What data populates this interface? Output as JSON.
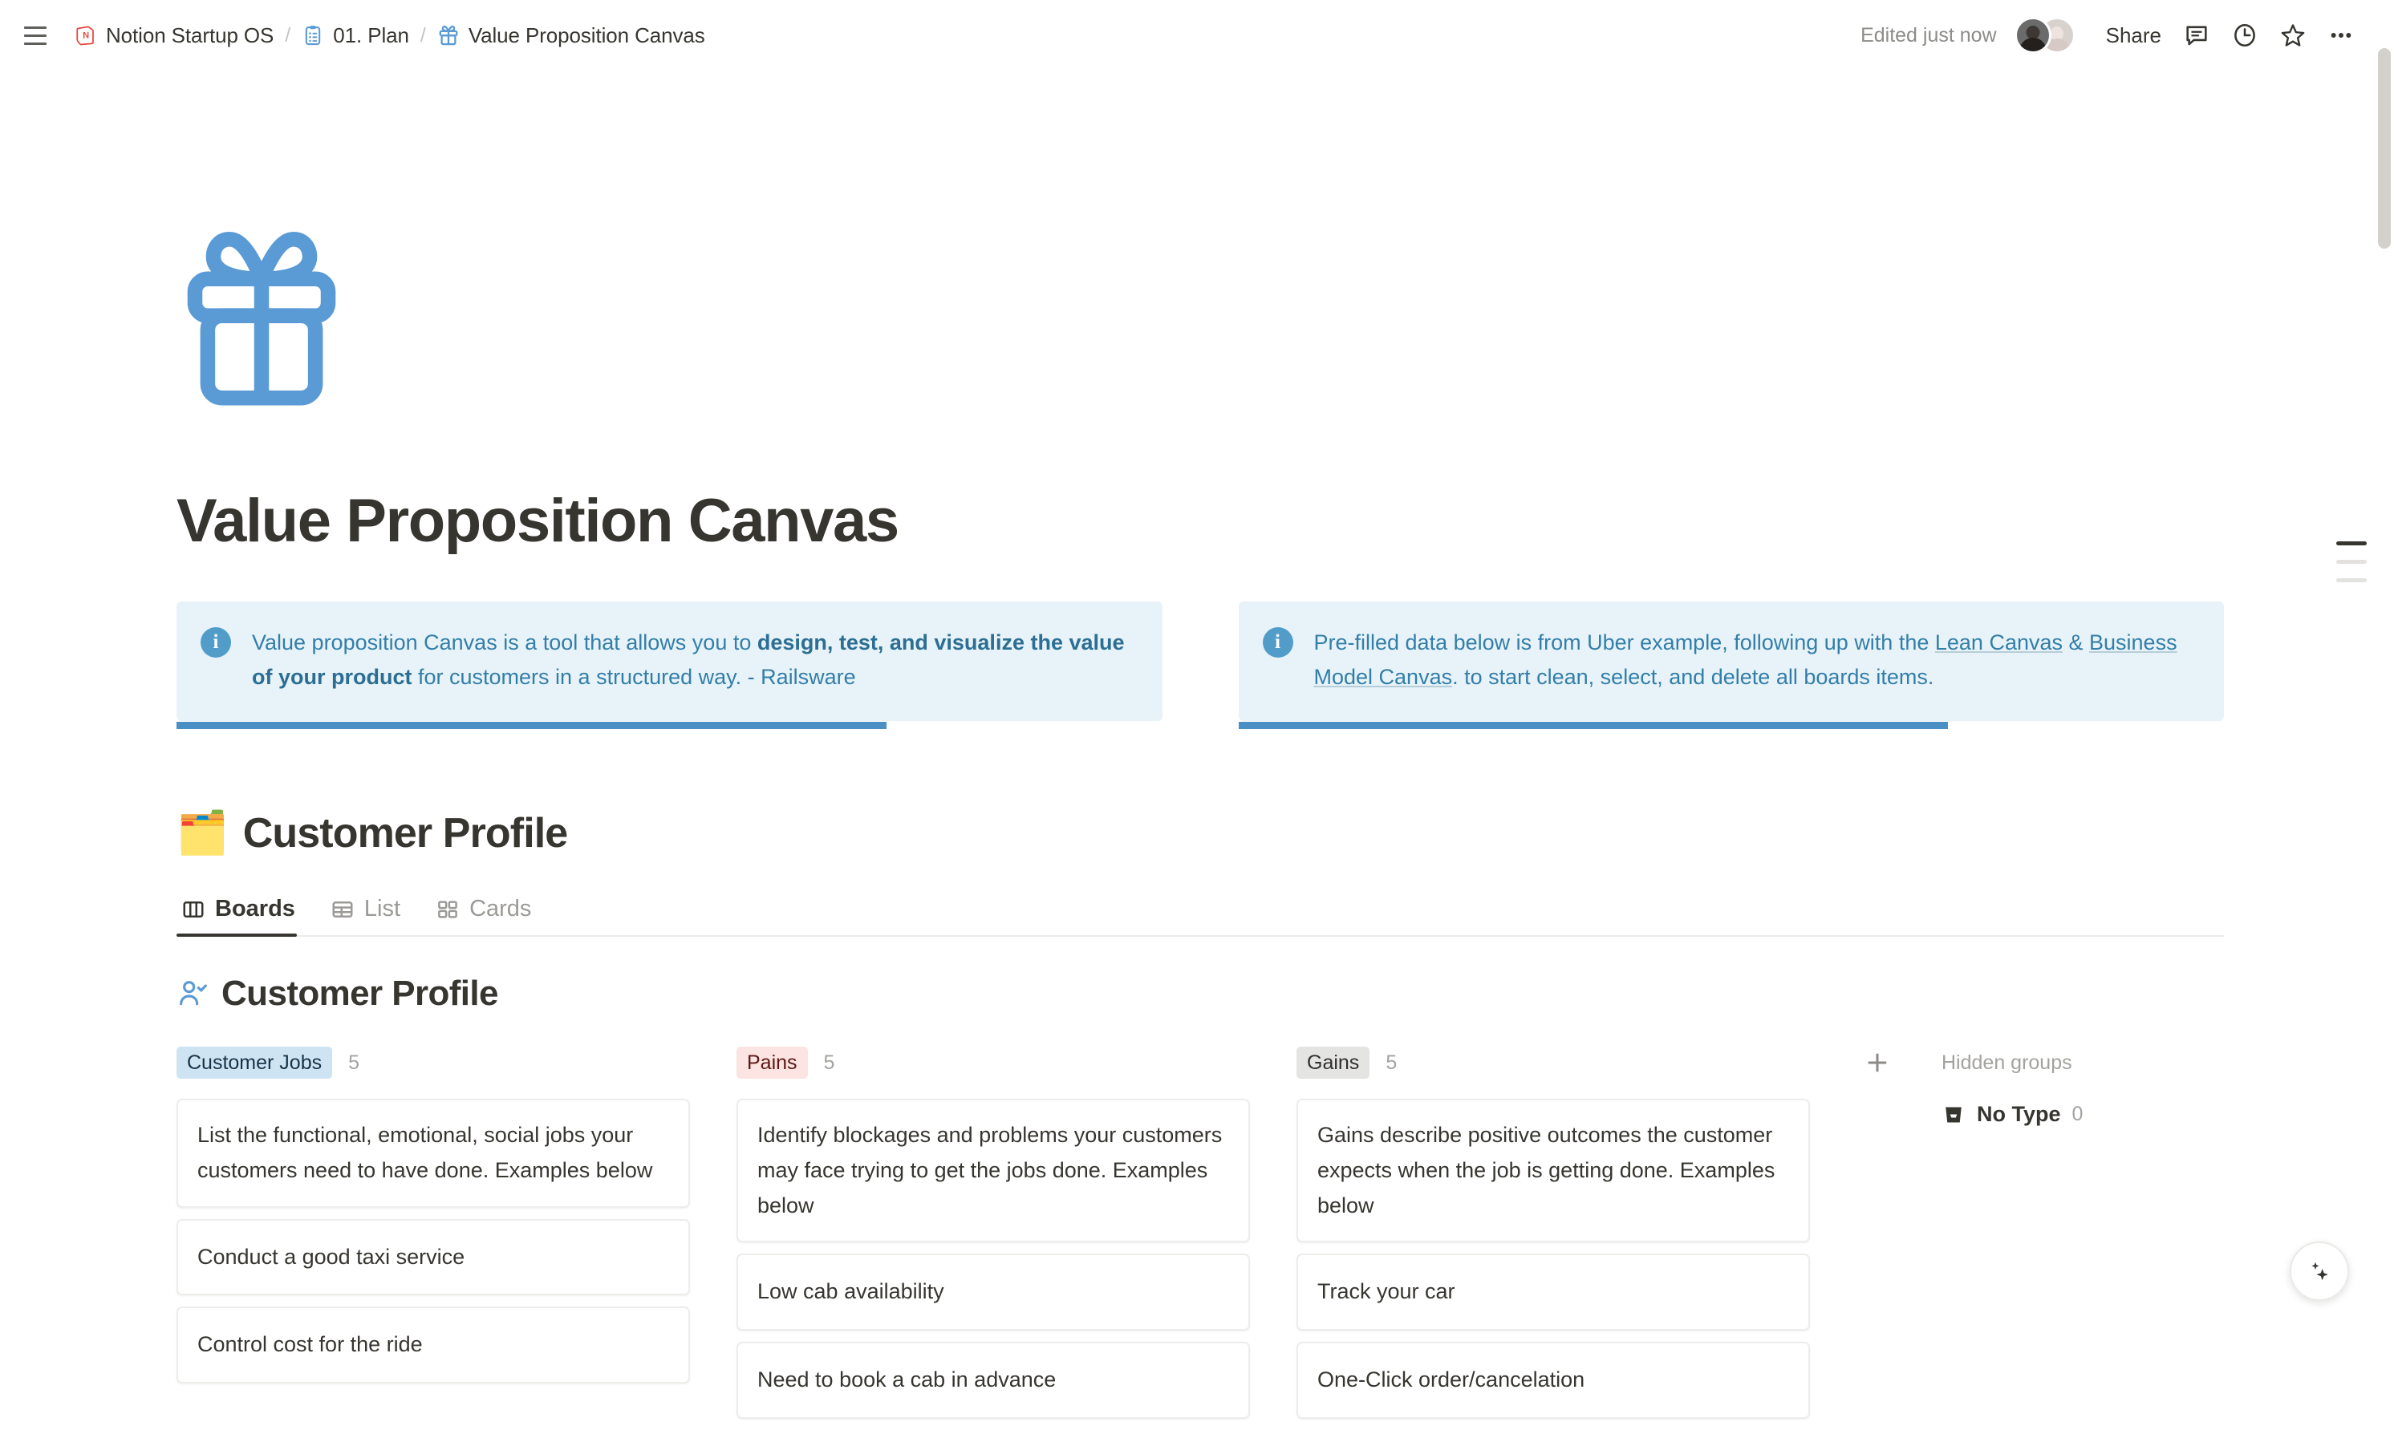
{
  "topbar": {
    "menu_icon": "hamburger-icon",
    "breadcrumbs": [
      {
        "icon": "notion-logo-icon",
        "label": "Notion Startup OS"
      },
      {
        "icon": "clipboard-icon",
        "label": "01. Plan"
      },
      {
        "icon": "gift-icon",
        "label": "Value Proposition Canvas"
      }
    ],
    "separator": "/",
    "edited_status": "Edited just now",
    "share_label": "Share",
    "actions": [
      {
        "name": "comment-icon"
      },
      {
        "name": "history-clock-icon"
      },
      {
        "name": "favorite-star-icon"
      },
      {
        "name": "more-options-icon"
      }
    ]
  },
  "page": {
    "icon": "gift-icon",
    "title": "Value Proposition Canvas",
    "callouts": [
      {
        "icon": "info-icon",
        "text_parts": [
          {
            "text": "Value proposition Canvas is a tool that allows you to ",
            "style": "normal"
          },
          {
            "text": "design, test, and visualize the value of your product",
            "style": "bold"
          },
          {
            "text": " for customers in a structured way. - Railsware",
            "style": "normal"
          }
        ]
      },
      {
        "icon": "info-icon",
        "text_parts": [
          {
            "text": "Pre-filled data below is from Uber example, following up with the ",
            "style": "normal"
          },
          {
            "text": "Lean Canvas",
            "style": "link"
          },
          {
            "text": " & ",
            "style": "normal"
          },
          {
            "text": "Business Model Canvas",
            "style": "link"
          },
          {
            "text": ". to start clean, select, and delete all boards items.",
            "style": "normal"
          }
        ]
      }
    ]
  },
  "section": {
    "emoji": "🗂️",
    "heading": "Customer Profile"
  },
  "database": {
    "tabs": [
      {
        "label": "Boards",
        "icon": "board-view-icon",
        "active": true
      },
      {
        "label": "List",
        "icon": "table-view-icon",
        "active": false
      },
      {
        "label": "Cards",
        "icon": "gallery-view-icon",
        "active": false
      }
    ],
    "board_title": "Customer Profile",
    "board_title_icon": "user-check-icon",
    "add_group_icon": "plus-icon",
    "hidden_groups": {
      "title": "Hidden groups",
      "items": [
        {
          "icon": "archive-icon",
          "label": "No Type",
          "count": "0"
        }
      ]
    },
    "columns": [
      {
        "name": "Customer Jobs",
        "chip_color": "blue",
        "count": "5",
        "cards": [
          "List the functional, emotional, social jobs your customers need to have done. Examples below",
          "Conduct a good taxi service",
          "Control cost for the ride"
        ]
      },
      {
        "name": "Pains",
        "chip_color": "red",
        "count": "5",
        "cards": [
          "Identify blockages and problems your customers may face trying to get the jobs done. Examples below",
          "Low cab availability",
          "Need to book a cab in advance"
        ]
      },
      {
        "name": "Gains",
        "chip_color": "gray",
        "count": "5",
        "cards": [
          "Gains describe positive outcomes the customer expects when the job is getting done. Examples below",
          "Track your car",
          "One-Click order/cancelation"
        ]
      }
    ]
  },
  "floating": {
    "ai_button_icon": "sparkle-ai-icon"
  },
  "colors": {
    "accent_blue": "#529cca",
    "callout_bg": "#e7f3f8",
    "callout_text": "#337ea9",
    "text": "#37352f",
    "muted": "#9b9a97",
    "chip_blue": "#cfe4f3",
    "chip_red": "#fbe4e1",
    "chip_gray": "#e4e4e2",
    "selection_blue": "#4a90c4"
  }
}
